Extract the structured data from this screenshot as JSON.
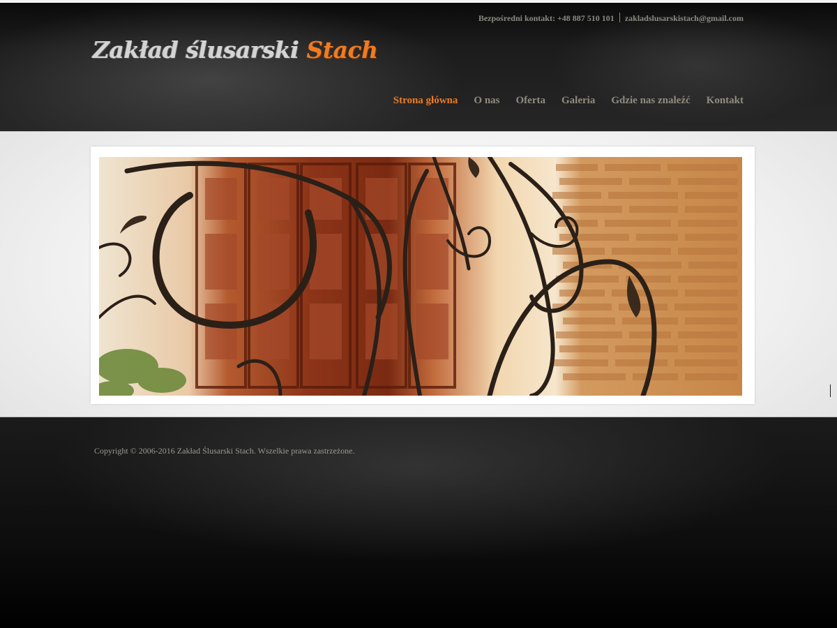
{
  "header": {
    "contact_label": "Bezpośredni kontakt: +48 887 510 101",
    "contact_email": "zakladslusarskistach@gmail.com",
    "logo_part1": "Zakład ślusarski ",
    "logo_part2": "Stach"
  },
  "nav": {
    "items": [
      {
        "label": "Strona główna"
      },
      {
        "label": "O nas"
      },
      {
        "label": "Oferta"
      },
      {
        "label": "Galeria"
      },
      {
        "label": "Gdzie nas znaleźć"
      },
      {
        "label": "Kontakt"
      }
    ],
    "active_index": 0
  },
  "footer": {
    "copyright": "Copyright © 2006-2016 Zakład Ślusarski Stach. Wszelkie prawa zastrzeżone."
  },
  "colors": {
    "accent": "#f07b22",
    "nav_text": "#8f8c80",
    "background": "#000000"
  }
}
